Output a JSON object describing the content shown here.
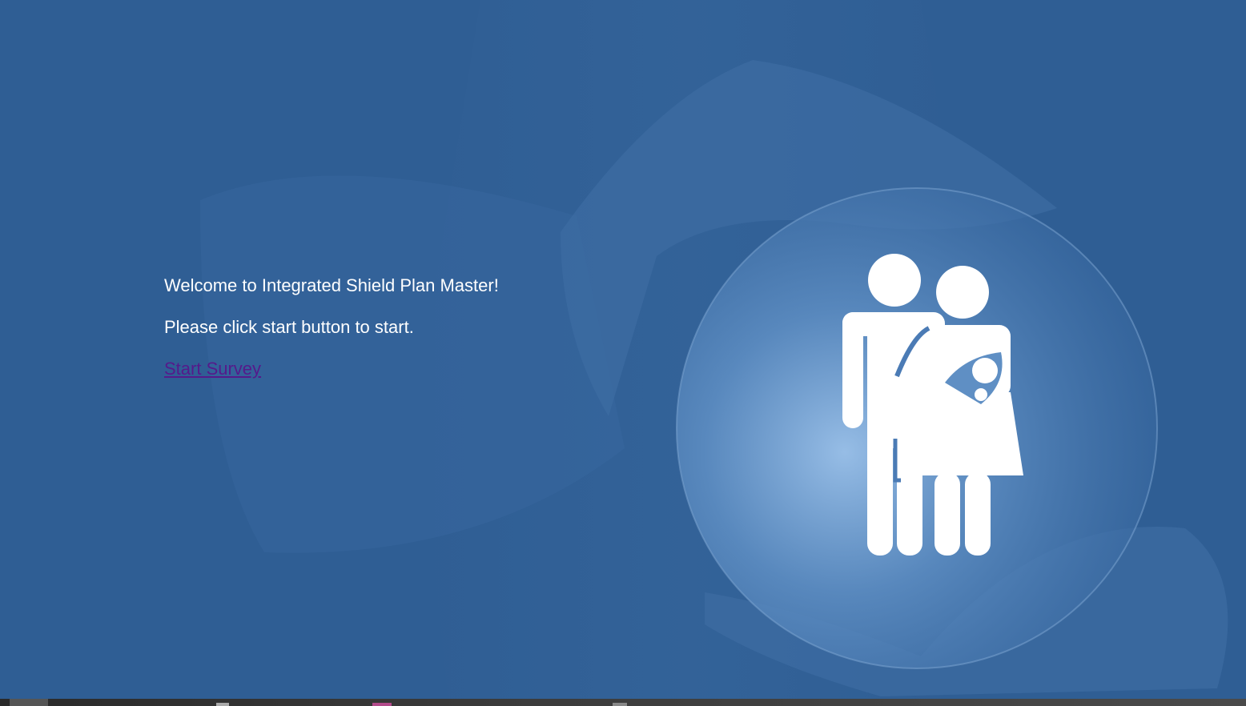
{
  "intro": {
    "welcome": "Welcome to Integrated Shield Plan Master!",
    "instruction": "Please click start button to start.",
    "start_link": "Start Survey"
  },
  "colors": {
    "background": "#2f5e94",
    "text": "#ffffff",
    "link_visited": "#551a8b"
  },
  "icons": {
    "hero": "family-shield-icon"
  }
}
